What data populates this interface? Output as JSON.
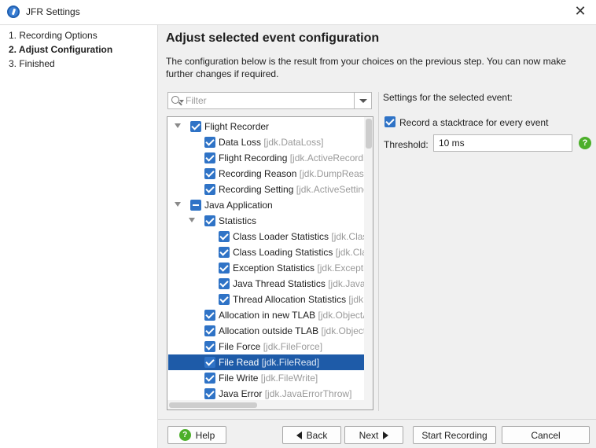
{
  "window": {
    "title": "JFR Settings",
    "close_glyph": "✕",
    "icon": "jfr-app-icon"
  },
  "nav": {
    "steps": [
      {
        "label": "1. Recording Options",
        "active": false
      },
      {
        "label": "2. Adjust Configuration",
        "active": true
      },
      {
        "label": "3. Finished",
        "active": false
      }
    ]
  },
  "page": {
    "heading": "Adjust selected event configuration",
    "description": "The configuration below is the result from your choices on the previous step. You can now make further changes if required."
  },
  "filter": {
    "placeholder": "Filter",
    "value": ""
  },
  "tree": {
    "rows": [
      {
        "label": "Flight Recorder",
        "id": "",
        "level": 0,
        "expanded": true,
        "state": "checked",
        "selected": false
      },
      {
        "label": "Data Loss",
        "id": "[jdk.DataLoss]",
        "level": 1,
        "expanded": null,
        "state": "checked",
        "selected": false
      },
      {
        "label": "Flight Recording",
        "id": "[jdk.ActiveRecordi",
        "level": 1,
        "expanded": null,
        "state": "checked",
        "selected": false
      },
      {
        "label": "Recording Reason",
        "id": "[jdk.DumpReaso",
        "level": 1,
        "expanded": null,
        "state": "checked",
        "selected": false
      },
      {
        "label": "Recording Setting",
        "id": "[jdk.ActiveSetting",
        "level": 1,
        "expanded": null,
        "state": "checked",
        "selected": false
      },
      {
        "label": "Java Application",
        "id": "",
        "level": 0,
        "expanded": true,
        "state": "partial",
        "selected": false
      },
      {
        "label": "Statistics",
        "id": "",
        "level": 1,
        "expanded": true,
        "state": "checked",
        "selected": false
      },
      {
        "label": "Class Loader Statistics",
        "id": "[jdk.Class",
        "level": 2,
        "expanded": null,
        "state": "checked",
        "selected": false
      },
      {
        "label": "Class Loading Statistics",
        "id": "[jdk.Clas",
        "level": 2,
        "expanded": null,
        "state": "checked",
        "selected": false
      },
      {
        "label": "Exception Statistics",
        "id": "[jdk.Exceptio",
        "level": 2,
        "expanded": null,
        "state": "checked",
        "selected": false
      },
      {
        "label": "Java Thread Statistics",
        "id": "[jdk.JavaTh",
        "level": 2,
        "expanded": null,
        "state": "checked",
        "selected": false
      },
      {
        "label": "Thread Allocation Statistics",
        "id": "[jdk.",
        "level": 2,
        "expanded": null,
        "state": "checked",
        "selected": false
      },
      {
        "label": "Allocation in new TLAB",
        "id": "[jdk.ObjectA",
        "level": 1,
        "expanded": null,
        "state": "checked",
        "selected": false
      },
      {
        "label": "Allocation outside TLAB",
        "id": "[jdk.Object",
        "level": 1,
        "expanded": null,
        "state": "checked",
        "selected": false
      },
      {
        "label": "File Force",
        "id": "[jdk.FileForce]",
        "level": 1,
        "expanded": null,
        "state": "checked",
        "selected": false
      },
      {
        "label": "File Read",
        "id": "[jdk.FileRead]",
        "level": 1,
        "expanded": null,
        "state": "checked",
        "selected": true
      },
      {
        "label": "File Write",
        "id": "[jdk.FileWrite]",
        "level": 1,
        "expanded": null,
        "state": "checked",
        "selected": false
      },
      {
        "label": "Java Error",
        "id": "[jdk.JavaErrorThrow]",
        "level": 1,
        "expanded": null,
        "state": "checked",
        "selected": false
      }
    ]
  },
  "settings": {
    "title": "Settings for the selected event:",
    "stacktrace_label": "Record a stacktrace for every event",
    "stacktrace_checked": true,
    "threshold_label": "Threshold:",
    "threshold_value": "10 ms",
    "help_glyph": "?"
  },
  "buttons": {
    "help": "Help",
    "help_glyph": "?",
    "back": "Back",
    "next": "Next",
    "start": "Start Recording",
    "cancel": "Cancel"
  },
  "colors": {
    "accent": "#2f73c6",
    "selection": "#1e5ba8",
    "help_green": "#4caf2a"
  }
}
